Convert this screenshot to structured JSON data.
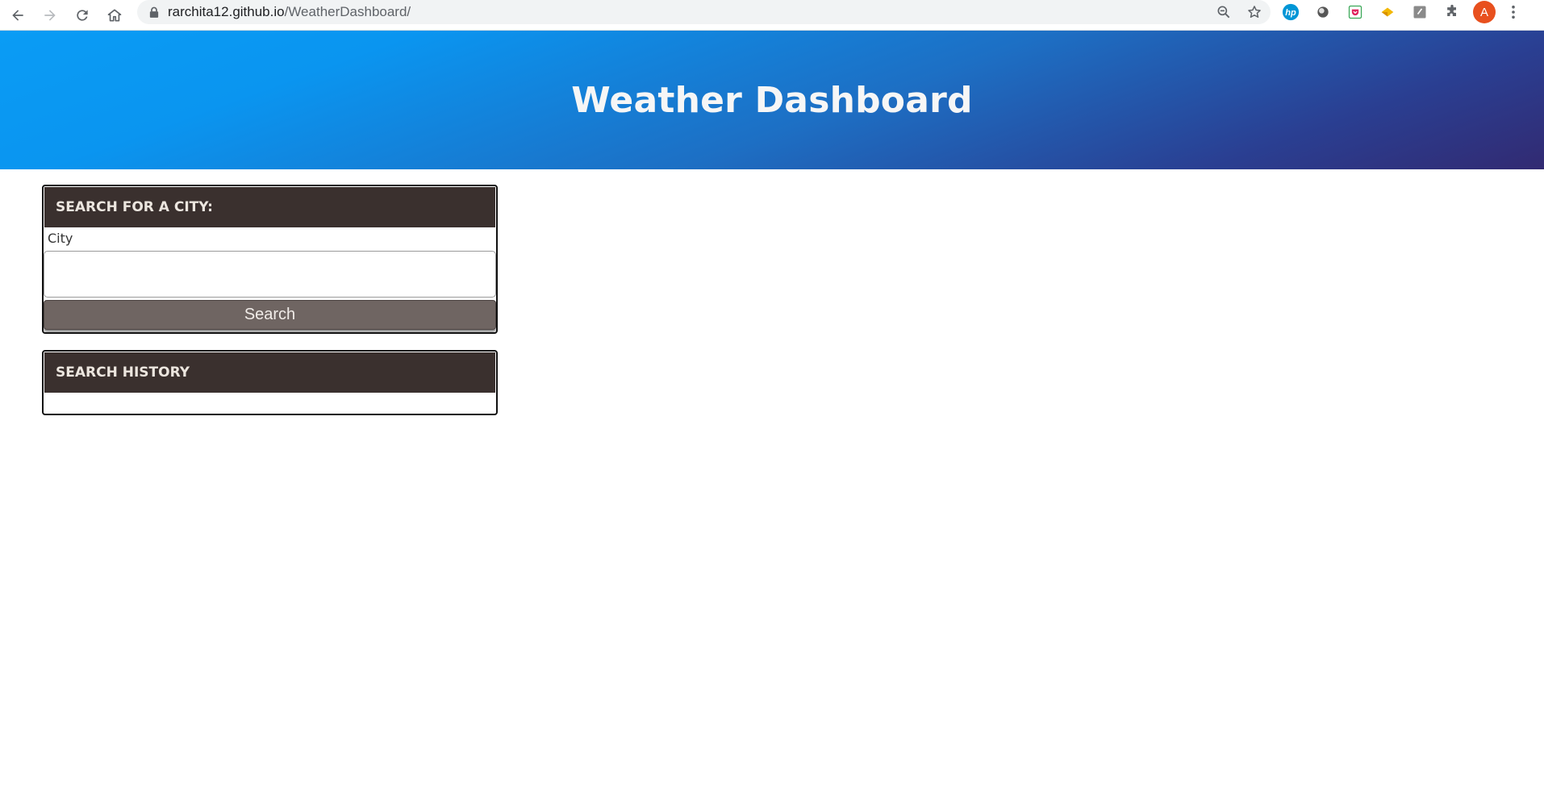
{
  "browser": {
    "url_host": "rarchita12.github.io",
    "url_path": "/WeatherDashboard/",
    "profile_initial": "A",
    "icons": {
      "back": "arrow-left-icon",
      "forward": "arrow-right-icon",
      "reload": "reload-icon",
      "home": "home-icon",
      "lock": "lock-icon",
      "zoom": "zoom-out-icon",
      "bookmark": "star-icon",
      "extensions": [
        "hp-extension-icon",
        "circle-extension-icon",
        "pocket-extension-icon",
        "diamond-extension-icon",
        "grey-extension-icon",
        "puzzle-icon"
      ],
      "menu": "kebab-menu-icon"
    }
  },
  "header": {
    "title": "Weather Dashboard",
    "gradient_colors": [
      "#0a9cf5",
      "#322a72"
    ]
  },
  "search_card": {
    "heading": "SEARCH FOR A CITY:",
    "city_label": "City",
    "city_value": "",
    "button_label": "Search"
  },
  "history_card": {
    "heading": "SEARCH HISTORY",
    "items": []
  },
  "colors": {
    "card_header": "#3a302e",
    "button": "#6f6562"
  }
}
